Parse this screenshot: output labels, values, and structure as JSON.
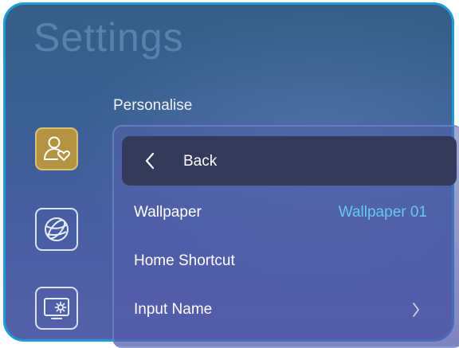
{
  "page": {
    "title": "Settings",
    "section": "Personalise"
  },
  "sidebar": {
    "items": [
      {
        "name": "personalise",
        "icon": "user-heart-icon",
        "active": true
      },
      {
        "name": "network",
        "icon": "globe-icon",
        "active": false
      },
      {
        "name": "system",
        "icon": "monitor-gear-icon",
        "active": false
      }
    ]
  },
  "panel": {
    "back_label": "Back",
    "rows": [
      {
        "label": "Wallpaper",
        "value": "Wallpaper 01"
      },
      {
        "label": "Home Shortcut"
      },
      {
        "label": "Input Name"
      }
    ]
  },
  "colors": {
    "accent_value": "#67c7f2",
    "active_tab": "#b49440",
    "frame_border": "#1d9bd6"
  }
}
